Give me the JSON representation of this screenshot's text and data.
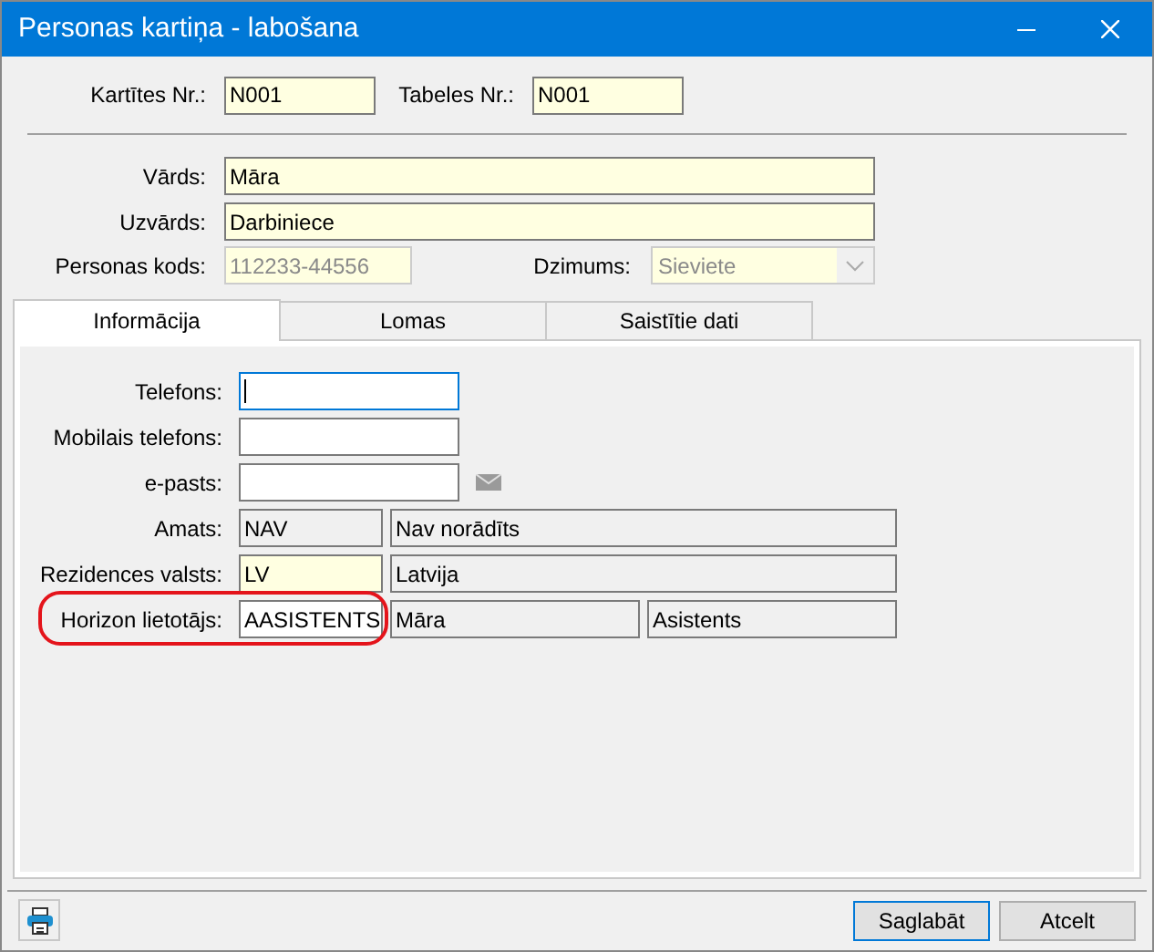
{
  "window": {
    "title": "Personas kartiņa - labošana"
  },
  "header_fields": [
    {
      "label": "Kartītes Nr.:",
      "value": "N001",
      "kind": "mandatory"
    },
    {
      "label": "Tabeles Nr.:",
      "value": "N001",
      "kind": "mandatory"
    }
  ],
  "person_fields": [
    {
      "label": "Vārds:",
      "value": "Māra",
      "kind": "mandatory"
    },
    {
      "label": "Uzvārds:",
      "value": "Darbiniece",
      "kind": "mandatory"
    }
  ],
  "personal_code": {
    "label": "Personas kods:",
    "value": "112233-44556",
    "disabled": true
  },
  "gender": {
    "label": "Dzimums:",
    "value": "Sieviete",
    "disabled": true
  },
  "tabs": [
    {
      "label": "Informācija",
      "selected": true
    },
    {
      "label": "Lomas",
      "selected": false
    },
    {
      "label": "Saistītie dati",
      "selected": false
    }
  ],
  "info_rows": [
    {
      "label": "Telefons:",
      "highlighted": false,
      "cells": [
        {
          "kind": "input",
          "focused": true
        }
      ]
    },
    {
      "label": "Mobilais telefons:",
      "highlighted": false,
      "cells": [
        {
          "kind": "input",
          "focused": false
        }
      ]
    },
    {
      "label": "e-pasts:",
      "highlighted": false,
      "mail_button": true,
      "cells": [
        {
          "kind": "input",
          "focused": false
        }
      ]
    },
    {
      "label": "Amats:",
      "highlighted": false,
      "cells": [
        {
          "value": "NAV",
          "kind": "readonly",
          "focused": false
        },
        {
          "value": "Nav norādīts",
          "kind": "readonly",
          "focused": false
        }
      ]
    },
    {
      "label": "Rezidences valsts:",
      "highlighted": false,
      "cells": [
        {
          "value": "LV",
          "kind": "mandatory",
          "focused": false
        },
        {
          "value": "Latvija",
          "kind": "readonly",
          "focused": false
        }
      ]
    },
    {
      "label": "Horizon lietotājs:",
      "highlighted": true,
      "cells": [
        {
          "value": "AASISTENTS",
          "kind": "input",
          "focused": false
        },
        {
          "value": "Māra",
          "kind": "readonly",
          "focused": false
        },
        {
          "value": "Asistents",
          "kind": "readonly",
          "focused": false
        }
      ]
    }
  ],
  "buttons": [
    {
      "label": "Saglabāt",
      "default": true
    },
    {
      "label": "Atcelt",
      "default": false
    }
  ]
}
